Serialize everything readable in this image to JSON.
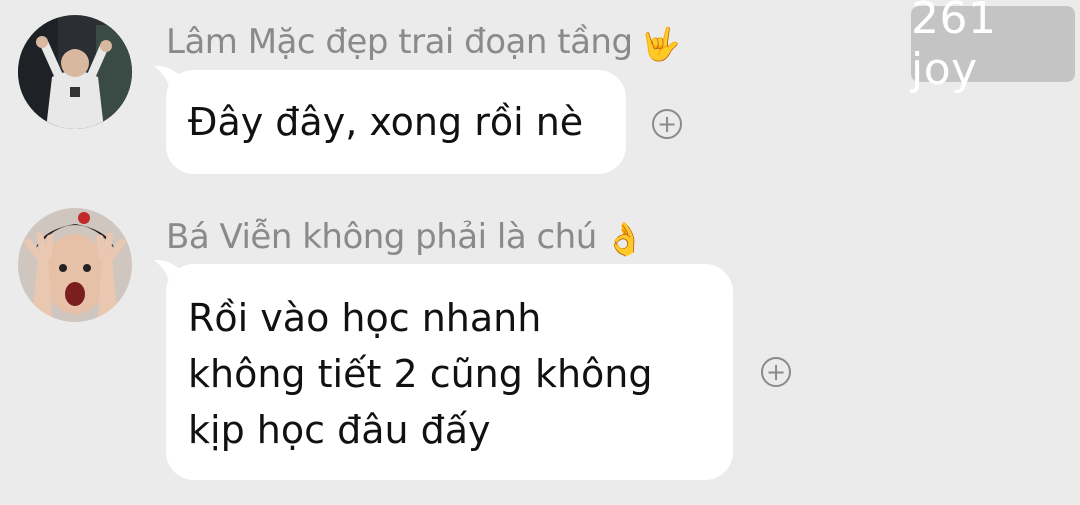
{
  "badge": {
    "text": "261 joy"
  },
  "messages": [
    {
      "sender": "Lâm Mặc đẹp trai đoạn tầng",
      "sender_emoji": "🤟",
      "avatar_icon": "avatar-photo",
      "lines": [
        "Đây đây, xong rồi nè"
      ],
      "react_icon": "+"
    },
    {
      "sender": "Bá Viễn không phải là chú",
      "sender_emoji": "👌",
      "avatar_icon": "avatar-photo",
      "lines": [
        "Rồi vào học nhanh",
        "không tiết 2 cũng không",
        "kịp học đâu đấy"
      ],
      "react_icon": "+"
    }
  ],
  "colors": {
    "background": "#ebebeb",
    "bubble": "#ffffff",
    "muted": "#8a8a8a",
    "badge": "#c4c4c4"
  }
}
